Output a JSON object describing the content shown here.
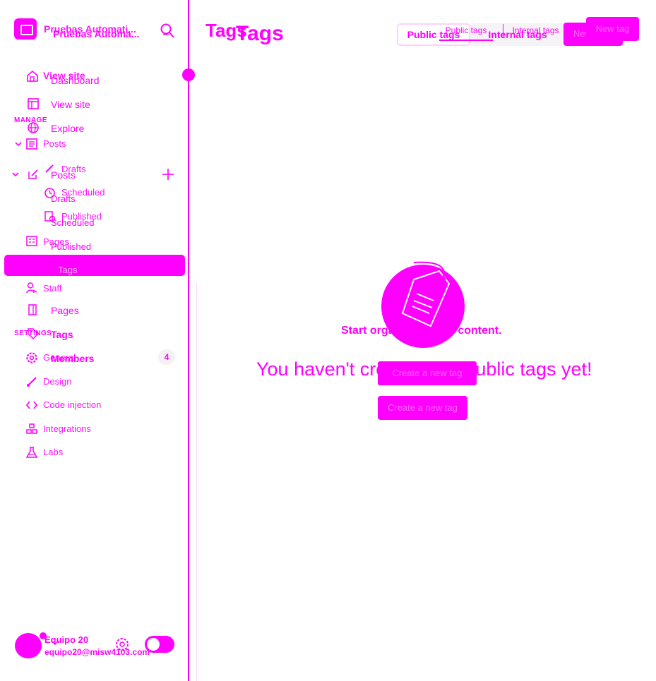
{
  "site": {
    "name_ghost": "Pruebas Automati...",
    "name": "Pruebas Automa..."
  },
  "sidebar": {
    "ghost_items": {
      "view_site": "View site",
      "manage_title": "MANAGE",
      "posts": "Posts",
      "drafts": "Drafts",
      "scheduled": "Scheduled",
      "published": "Published",
      "pages": "Pages",
      "tags": "Tags",
      "staff": "Staff",
      "settings_title": "SETTINGS",
      "general": "General",
      "design": "Design",
      "code_injection": "Code injection",
      "integrations": "Integrations",
      "labs": "Labs"
    },
    "items": {
      "dashboard": "Dashboard",
      "view_site": "View site",
      "explore": "Explore",
      "posts": "Posts",
      "drafts": "Drafts",
      "scheduled": "Scheduled",
      "published": "Published",
      "pages": "Pages",
      "tags": "Tags",
      "members": "Members",
      "members_count": "4"
    }
  },
  "user": {
    "name": "Equipo 20",
    "email": "equipo20@misw4103.com"
  },
  "header": {
    "title_ghost": "Tags",
    "title": "Tags",
    "tabs": {
      "public": "Public tags",
      "internal": "Internal tags",
      "public_ghost": "Public tags",
      "internal_ghost": "Internal tags"
    },
    "new_tag": "New tag",
    "new_tag_ghost": "New tag"
  },
  "empty_state": {
    "subtitle": "Start organizing your content.",
    "heading": "You haven't created any public tags yet!",
    "button_ghost": "Create a new tag",
    "button": "Create a new tag"
  },
  "colors": {
    "accent": "#ff00ff",
    "background": "#ffffff"
  }
}
